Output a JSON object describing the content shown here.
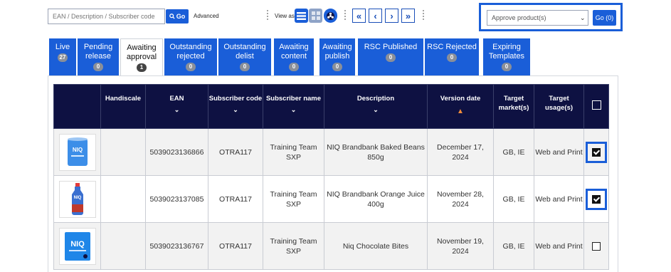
{
  "toolbar": {
    "search_placeholder": "EAN / Description / Subscriber code",
    "go_label": "Go",
    "advanced_label": "Advanced",
    "view_as_label": "View as",
    "approve_select_value": "Approve product(s)",
    "approve_go_label": "Go (0)",
    "pager": {
      "first": "«",
      "prev": "‹",
      "next": "›",
      "last": "»"
    }
  },
  "tabs": [
    {
      "label": "Live",
      "count": "27"
    },
    {
      "label": "Pending release",
      "count": "0"
    },
    {
      "label": "Awaiting approval",
      "count": "1"
    },
    {
      "label": "Outstanding rejected",
      "count": "0"
    },
    {
      "label": "Outstanding delist",
      "count": "0"
    },
    {
      "label": "Awaiting content",
      "count": "0"
    },
    {
      "label": "Awaiting publish",
      "count": "0"
    },
    {
      "label": "RSC Published",
      "count": "0"
    },
    {
      "label": "RSC Rejected",
      "count": "0"
    },
    {
      "label": "Expiring Templates",
      "count": "0"
    }
  ],
  "table": {
    "headers": [
      "",
      "Handiscale",
      "EAN",
      "Subscriber code",
      "Subscriber name",
      "Description",
      "Version date",
      "Target market(s)",
      "Target usage(s)",
      ""
    ],
    "rows": [
      {
        "image": "baked-beans-can",
        "ean": "5039023136866",
        "subscriber_code": "OTRA117",
        "subscriber_name": "Training Team SXP",
        "description": "NIQ Brandbank Baked Beans 850g",
        "version_date": "December 17, 2024",
        "markets": "GB, IE",
        "usage": "Web and Print",
        "checked": true
      },
      {
        "image": "orange-juice-bottle",
        "ean": "5039023137085",
        "subscriber_code": "OTRA117",
        "subscriber_name": "Training Team SXP",
        "description": "NIQ Brandbank Orange Juice 400g",
        "version_date": "November 28, 2024",
        "markets": "GB, IE",
        "usage": "Web and Print",
        "checked": true
      },
      {
        "image": "chocolate-bites-box",
        "ean": "5039023136767",
        "subscriber_code": "OTRA117",
        "subscriber_name": "Training Team SXP",
        "description": "Niq Chocolate Bites",
        "version_date": "November 19, 2024",
        "markets": "GB, IE",
        "usage": "Web and Print",
        "checked": false
      }
    ]
  },
  "product_logo_text": "NIQ",
  "colors": {
    "accent": "#1a5ed8",
    "header_bg": "#0e1142",
    "sort_arrow": "#f08c3a"
  }
}
